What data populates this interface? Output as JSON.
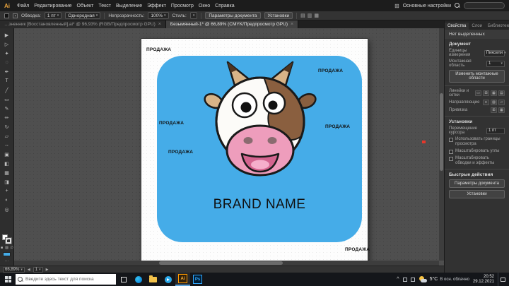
{
  "icons": {
    "chevron_down": "▾",
    "close": "×",
    "menu_grid": "⊞",
    "prev": "◀",
    "next": "▶",
    "ellipsis": "…",
    "caret_up": "^"
  },
  "colors": {
    "card_blue": "#45ACE8",
    "cow_white": "#FCFBF8",
    "patch_brown": "#8A5F3F",
    "horn_tan": "#D8B488",
    "horn_tip": "#4F3521",
    "muzzle_pink": "#EE9DBC",
    "nostril": "#8A6B70",
    "mouth_dark": "#D4648F",
    "tongue_pink": "#F6AECB",
    "outline": "#1A1A1A"
  },
  "menubar": {
    "logo": "Ai",
    "items": [
      "Файл",
      "Редактирование",
      "Объект",
      "Текст",
      "Выделение",
      "Эффект",
      "Просмотр",
      "Окно",
      "Справка"
    ],
    "workspace": "Основные настройки"
  },
  "controlbar": {
    "stroke_label": "Обводка:",
    "stroke_value": "1 пт",
    "brush_value": "Однородная",
    "opacity_label": "Непрозрачность:",
    "opacity_value": "100%",
    "style_label": "Стиль:",
    "document_setup": "Параметры документа",
    "preferences": "Установки",
    "extra_icons": [
      {
        "name": "align-horizontal-icon",
        "glyph": "▤"
      },
      {
        "name": "align-vertical-icon",
        "glyph": "▥"
      },
      {
        "name": "distribute-icon",
        "glyph": "▦"
      }
    ]
  },
  "tabbar": {
    "tabs": [
      "…зненник [Восстановленный].ai* @ 96,93% (RGB/Предпросмотр GPU)",
      "Безымянный-1* @ 66,89% (CMYK/Предпросмотр GPU)"
    ]
  },
  "toolbar": {
    "tools": [
      {
        "name": "selection-tool",
        "glyph": "▶"
      },
      {
        "name": "direct-selection-tool",
        "glyph": "▷"
      },
      {
        "name": "magic-wand-tool",
        "glyph": "✦"
      },
      {
        "name": "lasso-tool",
        "glyph": "◌"
      },
      {
        "name": "pen-tool",
        "glyph": "✒"
      },
      {
        "name": "type-tool",
        "glyph": "T"
      },
      {
        "name": "line-tool",
        "glyph": "╱"
      },
      {
        "name": "rectangle-tool",
        "glyph": "▭"
      },
      {
        "name": "paintbrush-tool",
        "glyph": "✎"
      },
      {
        "name": "pencil-tool",
        "glyph": "✏"
      },
      {
        "name": "rotate-tool",
        "glyph": "↻"
      },
      {
        "name": "scale-tool",
        "glyph": "▱"
      },
      {
        "name": "width-tool",
        "glyph": "↔"
      },
      {
        "name": "free-transform-tool",
        "glyph": "▣"
      },
      {
        "name": "shape-builder-tool",
        "glyph": "◧"
      },
      {
        "name": "mesh-tool",
        "glyph": "▦"
      },
      {
        "name": "gradient-tool",
        "glyph": "◨"
      },
      {
        "name": "eyedropper-tool",
        "glyph": "+"
      },
      {
        "name": "blend-tool",
        "glyph": "◐"
      },
      {
        "name": "zoom-tool",
        "glyph": "◎"
      }
    ],
    "mini": [
      {
        "name": "color-button",
        "glyph": "■"
      },
      {
        "name": "gradient-button",
        "glyph": "▨"
      },
      {
        "name": "none-button",
        "glyph": "∅"
      }
    ]
  },
  "artboard": {
    "brand_name": "BRAND NAME",
    "watermark": "ПРОДАЖА"
  },
  "right_panel": {
    "tabs": [
      "Свойства",
      "Слои",
      "Библиотеки"
    ],
    "no_selection": "Нет выделенных",
    "document_section": "Документ",
    "units_label": "Единицы измерения",
    "units_value": "Пиксели",
    "artboard_label": "Монтажная область",
    "artboard_value": "1",
    "edit_artboards": "Изменить монтажные области",
    "rulers_label": "Линейки и сетки",
    "rulers_icons": [
      {
        "name": "show-rulers-icon",
        "glyph": "▭"
      },
      {
        "name": "show-grid-icon",
        "glyph": "⊞"
      },
      {
        "name": "snap-grid-icon",
        "glyph": "▦"
      },
      {
        "name": "pixel-grid-icon",
        "glyph": "▤"
      }
    ],
    "guides_label": "Направляющие",
    "guides_icons": [
      {
        "name": "show-guides-icon",
        "glyph": "≡"
      },
      {
        "name": "lock-guides-icon",
        "glyph": "▨"
      },
      {
        "name": "snap-guides-icon",
        "glyph": "▱"
      }
    ],
    "snap_label": "Привязка",
    "snap_icons": [
      {
        "name": "snap-point-icon",
        "glyph": "⊞"
      },
      {
        "name": "snap-pixel-icon",
        "glyph": "▦"
      }
    ],
    "prefs_section": "Установки",
    "increment_label": "Перемещение курсора",
    "increment_value": "1 пт",
    "checkbox_1": "Использовать границы просмотра",
    "checkbox_2": "Масштабировать углы",
    "checkbox_3": "Масштабировать обводки и эффекты",
    "quick_actions": "Быстрые действия",
    "action_doc_setup": "Параметры документа",
    "action_prefs": "Установки"
  },
  "ai_statusbar": {
    "zoom": "66,89%",
    "artboard_value": "1"
  },
  "taskbar": {
    "search_placeholder": "Введите здесь текст для поиска",
    "app_ai": "Ai",
    "app_ps": "Ps",
    "weather_temp": "5°C",
    "weather_desc": "В осн. облачно",
    "time": "20:52",
    "date": "29.12.2021"
  }
}
